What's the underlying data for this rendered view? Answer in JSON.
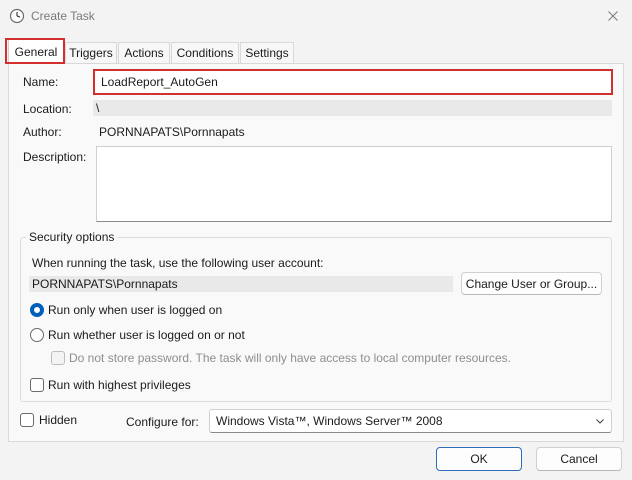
{
  "window": {
    "title": "Create Task",
    "icon": "clock-icon"
  },
  "tabs": [
    {
      "label": "General",
      "active": true
    },
    {
      "label": "Triggers",
      "active": false
    },
    {
      "label": "Actions",
      "active": false
    },
    {
      "label": "Conditions",
      "active": false
    },
    {
      "label": "Settings",
      "active": false
    }
  ],
  "general": {
    "name_label": "Name:",
    "name_value": "LoadReport_AutoGen",
    "location_label": "Location:",
    "location_value": "\\",
    "author_label": "Author:",
    "author_value": "PORNNAPATS\\Pornnapats",
    "description_label": "Description:",
    "description_value": ""
  },
  "security": {
    "legend": "Security options",
    "account_prompt": "When running the task, use the following user account:",
    "account_value": "PORNNAPATS\\Pornnapats",
    "change_button": "Change User or Group...",
    "radio_logged_on": "Run only when user is logged on",
    "radio_logged_on_selected": true,
    "radio_whether": "Run whether user is logged on or not",
    "radio_whether_selected": false,
    "no_store_password": "Do not store password.  The task will only have access to local computer resources.",
    "highest_privileges": "Run with highest privileges"
  },
  "bottom": {
    "hidden_label": "Hidden",
    "configure_label": "Configure for:",
    "configure_value": "Windows Vista™, Windows Server™ 2008"
  },
  "footer": {
    "ok_label": "OK",
    "cancel_label": "Cancel"
  },
  "colors": {
    "highlight": "#d32f2f",
    "accent": "#005fb8"
  }
}
